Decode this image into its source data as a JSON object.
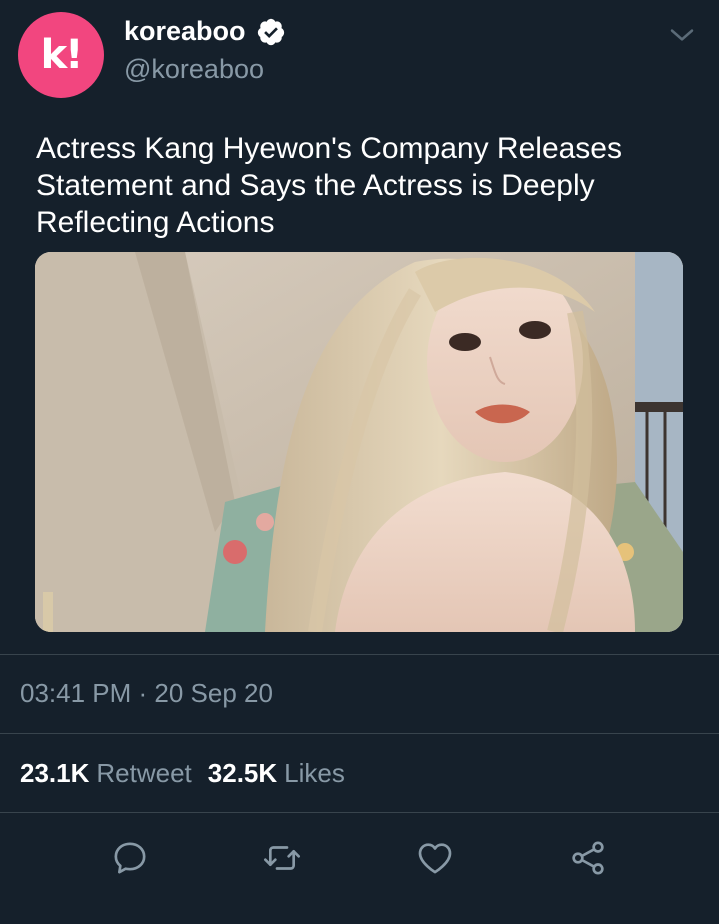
{
  "author": {
    "display_name": "koreaboo",
    "handle": "@koreaboo",
    "verified": true,
    "avatar_icon": "koreaboo-k-logo",
    "avatar_color": "#f2467f"
  },
  "tweet": {
    "text": "Actress Kang Hyewon's Company Releases Statement and Says the Actress is Deeply Reflecting Actions",
    "timestamp": "03:41 PM · 20 Sep 20"
  },
  "stats": {
    "retweets_count": "23.1K",
    "retweets_label": "Retweet",
    "likes_count": "32.5K",
    "likes_label": "Likes"
  },
  "actions": {
    "reply_icon": "reply-icon",
    "retweet_icon": "retweet-icon",
    "like_icon": "heart-icon",
    "share_icon": "share-icon"
  },
  "colors": {
    "background": "#15202b",
    "secondary_text": "#8899a6",
    "icon": "#8899a6",
    "divider": "#38444d",
    "accent": "#1da1f2"
  }
}
